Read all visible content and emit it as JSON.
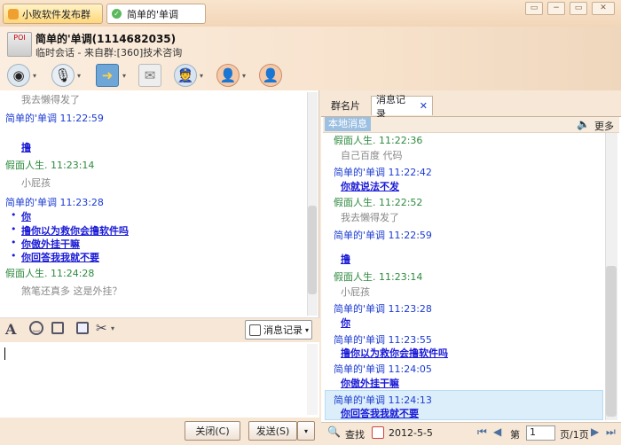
{
  "titlebar": {
    "tab_group": "小败软件发布群",
    "tab_chat": "简单的'单调",
    "btn_skin": "▭",
    "btn_min": "−",
    "btn_max": "▭",
    "btn_close": "✕"
  },
  "header": {
    "avatar_text": "POI",
    "contact_name": "简单的'单调(1114682035)",
    "contact_sub": "临时会话 - 来自群:[360]技术咨询"
  },
  "toolbar": {
    "icons": [
      "webcam-icon",
      "microphone-icon",
      "file-transfer-icon",
      "message-box-icon",
      "group-admin-icon",
      "contacts-icon",
      "add-contact-icon"
    ]
  },
  "left_messages": {
    "cut_top": "我去懒得发了",
    "m1_head": "简单的'单调  11:22:59",
    "m1_body": "撸",
    "m2_head": "假面人生.  11:23:14",
    "m2_body": "小屁孩",
    "m3_head": "简单的'单调  11:23:28",
    "m3_l1": "你",
    "m3_l2": "撸你以为救你会撸软件吗",
    "m3_l3": "你傲外挂干嘛",
    "m3_l4": "你回答我我就不要",
    "m4_head": "假面人生.  11:24:28",
    "m4_body": "煞笔还真多 这是外挂？"
  },
  "format_bar": {
    "msg_history": "消息记录"
  },
  "bottom": {
    "close": "关闭(C)",
    "send": "发送(S)"
  },
  "right": {
    "tab_card": "群名片",
    "tab_history": "消息记录",
    "local_msg": "本地消息",
    "more": "更多",
    "r1_head": "假面人生.  11:22:36",
    "r1_body": "自己百度 代码",
    "r2_head": "简单的'单调  11:22:42",
    "r2_body": "你就说法不发",
    "r3_head": "假面人生.  11:22:52",
    "r3_body": "我去懒得发了",
    "r4_head": "简单的'单调  11:22:59",
    "r4_body": "撸",
    "r5_head": "假面人生.  11:23:14",
    "r5_body": "小屁孩",
    "r6_head": "简单的'单调  11:23:28",
    "r6_body": "你",
    "r7_head": "简单的'单调  11:23:55",
    "r7_body": "撸你以为救你会撸软件吗",
    "r8_head": "简单的'单调  11:24:05",
    "r8_body": "你傲外挂干嘛",
    "r9_head": "简单的'单调  11:24:13",
    "r9_body": "你回答我我就不要"
  },
  "right_bottom": {
    "search": "查找",
    "date": "2012-5-5",
    "page_label": "第",
    "page_value": "1",
    "page_total": "页/1页"
  },
  "colors": {
    "sender_green": "#2d8a3e",
    "sender_blue": "#1b3bd2",
    "accent_blue": "#9cc0e2"
  }
}
